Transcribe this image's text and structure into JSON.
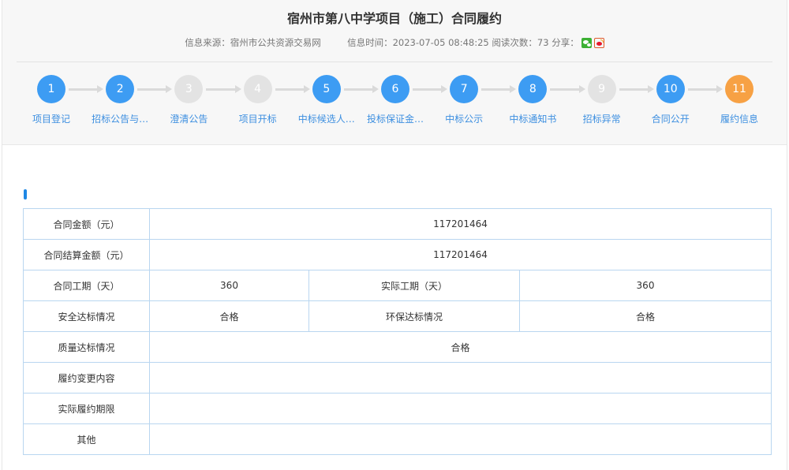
{
  "header": {
    "title": "宿州市第八中学项目（施工）合同履约",
    "source_label": "信息来源：",
    "source_value": "宿州市公共资源交易网",
    "time_label": "信息时间：",
    "time_value": "2023-07-05 08:48:25",
    "views_label": "阅读次数：",
    "views_value": "73",
    "share_label": "分享：",
    "share_icons": [
      "wechat-icon",
      "weibo-icon"
    ]
  },
  "steps": [
    {
      "num": "1",
      "label": "项目登记",
      "state": "active"
    },
    {
      "num": "2",
      "label": "招标公告与…",
      "state": "active"
    },
    {
      "num": "3",
      "label": "澄清公告",
      "state": "inactive"
    },
    {
      "num": "4",
      "label": "项目开标",
      "state": "inactive"
    },
    {
      "num": "5",
      "label": "中标候选人…",
      "state": "active"
    },
    {
      "num": "6",
      "label": "投标保证金…",
      "state": "active"
    },
    {
      "num": "7",
      "label": "中标公示",
      "state": "active"
    },
    {
      "num": "8",
      "label": "中标通知书",
      "state": "active"
    },
    {
      "num": "9",
      "label": "招标异常",
      "state": "inactive"
    },
    {
      "num": "10",
      "label": "合同公开",
      "state": "active"
    },
    {
      "num": "11",
      "label": "履约信息",
      "state": "current"
    }
  ],
  "colors": {
    "active": "#3d9cf3",
    "inactive": "#e3e3e3",
    "current": "#f7a144",
    "link": "#3d8fe0",
    "table_border": "#b9d6f0"
  },
  "table": {
    "contract_amount_label": "合同金额（元）",
    "contract_amount_value": "117201464",
    "settlement_amount_label": "合同结算金额（元）",
    "settlement_amount_value": "117201464",
    "contract_period_label": "合同工期（天）",
    "contract_period_value": "360",
    "actual_period_label": "实际工期（天）",
    "actual_period_value": "360",
    "safety_label": "安全达标情况",
    "safety_value": "合格",
    "environment_label": "环保达标情况",
    "environment_value": "合格",
    "quality_label": "质量达标情况",
    "quality_value": "合格",
    "change_label": "履约变更内容",
    "change_value": "",
    "deadline_label": "实际履约期限",
    "deadline_value": "",
    "other_label": "其他",
    "other_value": ""
  }
}
